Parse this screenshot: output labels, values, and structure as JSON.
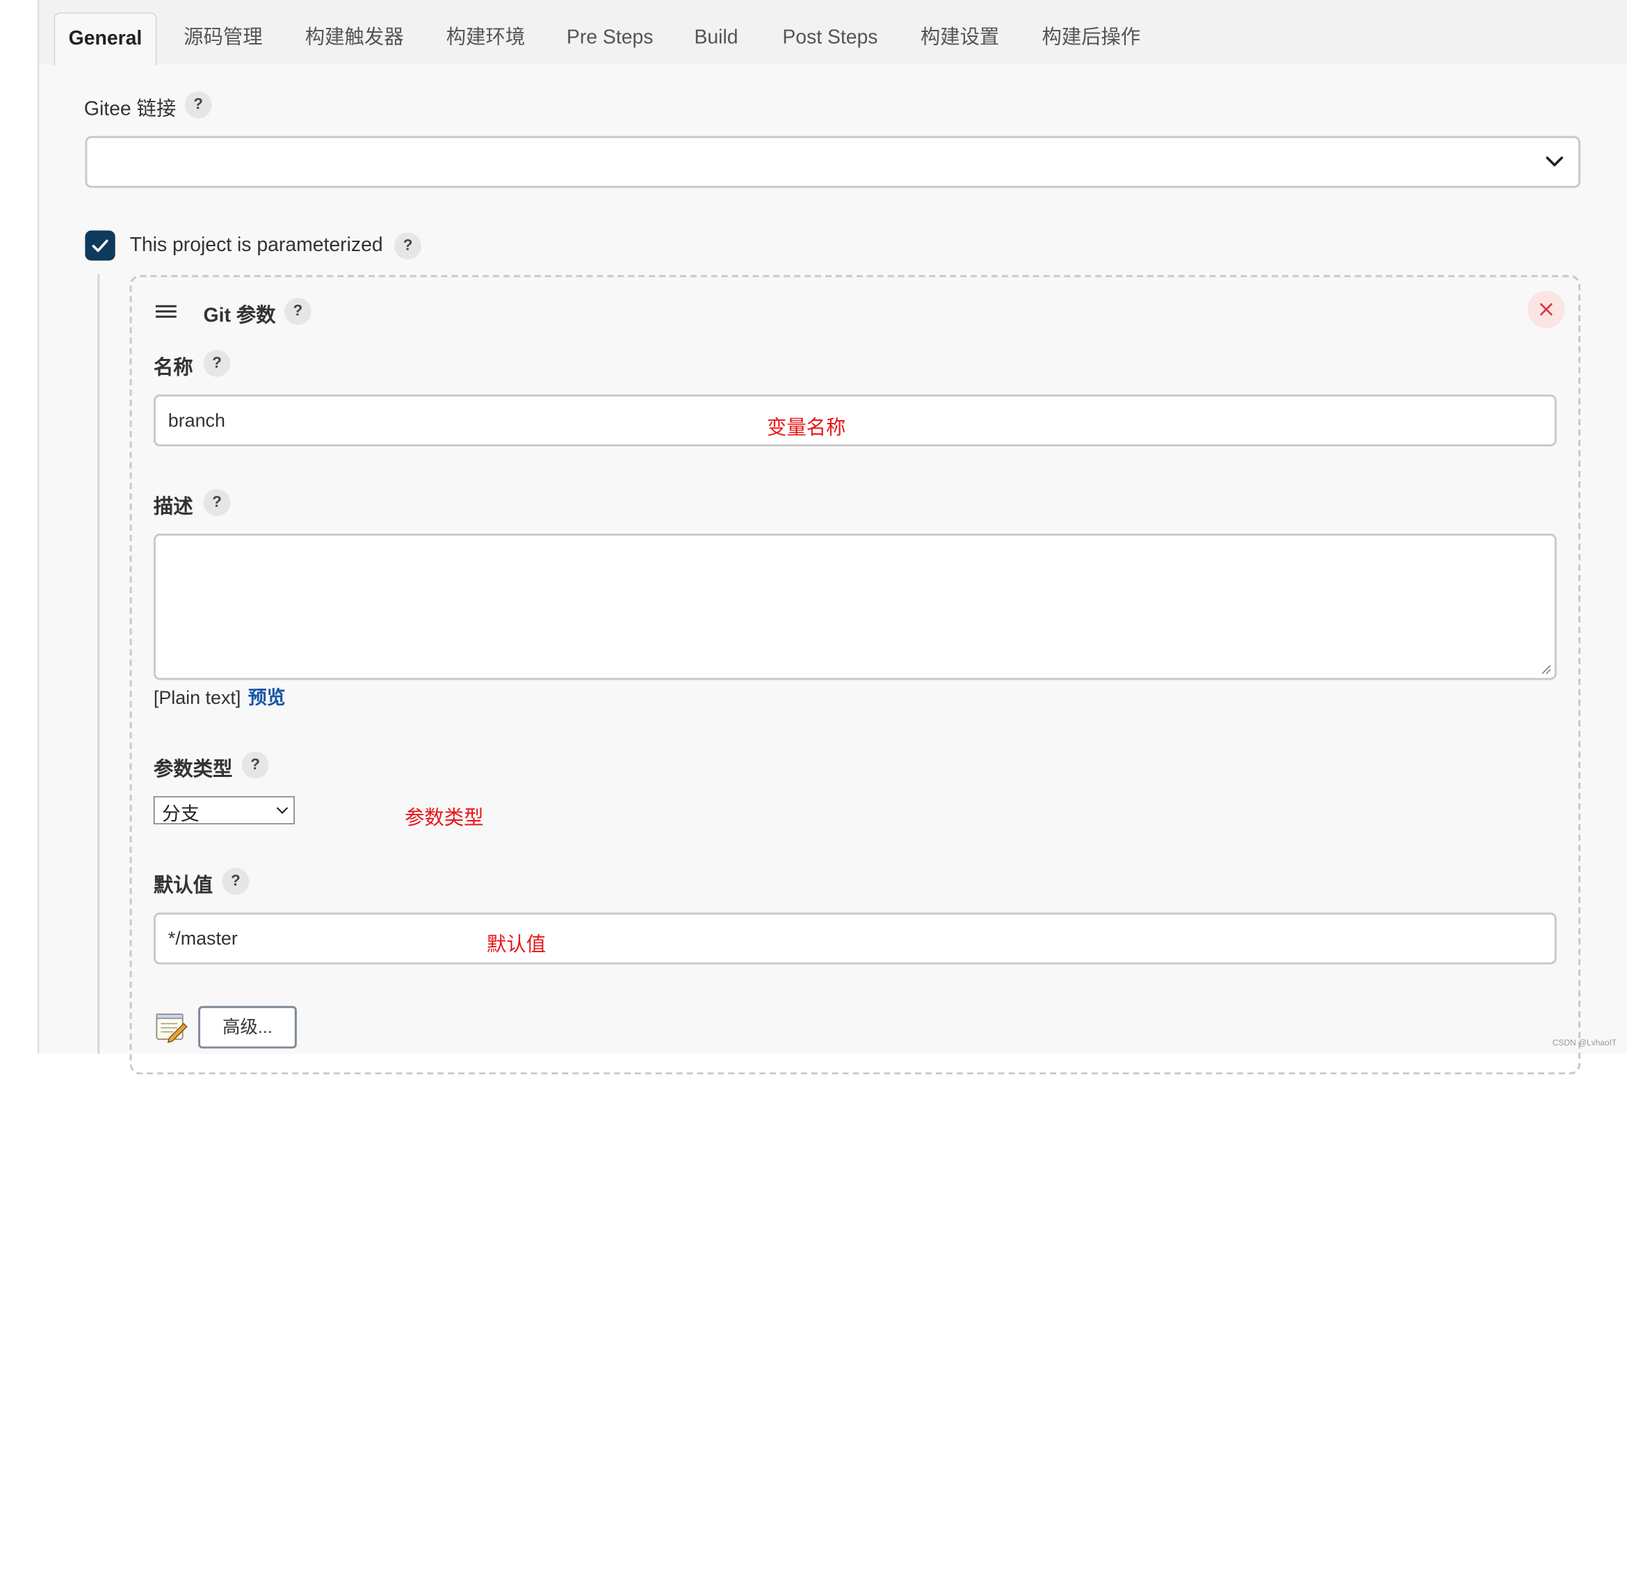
{
  "tabs": [
    {
      "label": "General",
      "active": true
    },
    {
      "label": "源码管理",
      "active": false
    },
    {
      "label": "构建触发器",
      "active": false
    },
    {
      "label": "构建环境",
      "active": false
    },
    {
      "label": "Pre Steps",
      "active": false
    },
    {
      "label": "Build",
      "active": false
    },
    {
      "label": "Post Steps",
      "active": false
    },
    {
      "label": "构建设置",
      "active": false
    },
    {
      "label": "构建后操作",
      "active": false
    }
  ],
  "help_glyph": "?",
  "gitee": {
    "label": "Gitee 链接",
    "selected_value": ""
  },
  "parameterized": {
    "label": "This project is parameterized",
    "checked": true
  },
  "git_param": {
    "title": "Git 参数",
    "name": {
      "label": "名称",
      "value": "branch",
      "annotation": "变量名称"
    },
    "description": {
      "label": "描述",
      "value": "",
      "format_label": "[Plain text]",
      "preview_link": "预览"
    },
    "param_type": {
      "label": "参数类型",
      "selected_value": "分支",
      "annotation": "参数类型"
    },
    "default_value": {
      "label": "默认值",
      "value": "*/master",
      "annotation": "默认值"
    },
    "advanced_button": "高级..."
  },
  "watermark": "CSDN @LvhaoIT",
  "colors": {
    "annotation_red": "#e8161a",
    "checkbox_blue": "#0e3a5c",
    "link_blue": "#1a56a8",
    "close_red": "#d9363e"
  },
  "icons": {
    "dropdown": "chevron-down-icon",
    "checkbox": "checkmark-icon",
    "drag_handle": "drag-handle-icon",
    "close": "close-icon",
    "notepad": "notepad-icon",
    "resize": "resize-grip-icon"
  }
}
